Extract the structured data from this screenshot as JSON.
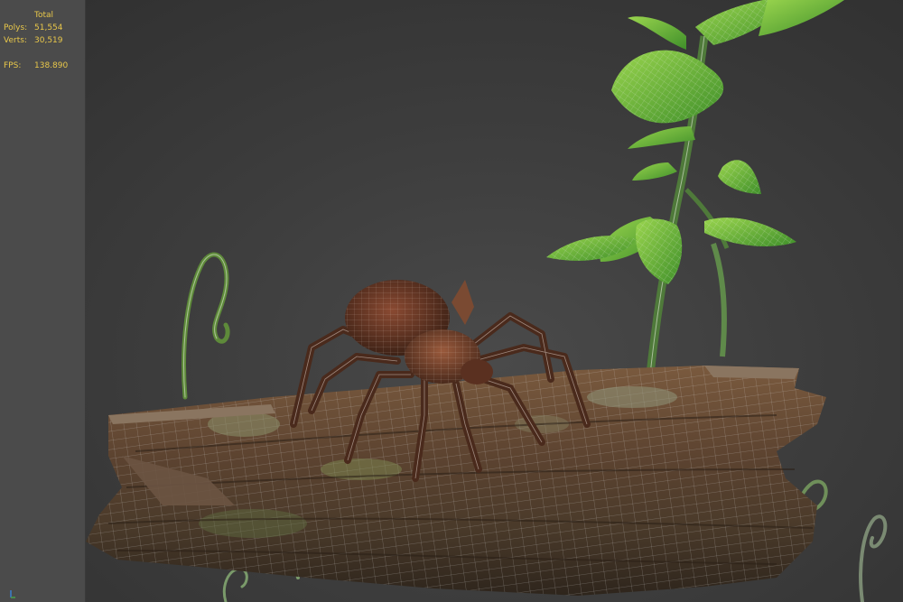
{
  "stats": {
    "header": "Total",
    "polys_label": "Polys:",
    "polys_value": "51,554",
    "verts_label": "Verts:",
    "verts_value": "30,519",
    "fps_label": "FPS:",
    "fps_value": "138.890"
  },
  "colors": {
    "stats_text": "#e8c74a",
    "background": "#3d3d3d",
    "wireframe": "#d8d8d8",
    "leaf": "#5fb23a",
    "log_bark": "#6a4a32",
    "spider": "#6b3b27"
  },
  "scene": {
    "objects": [
      "spider-model",
      "log-model",
      "vine-plant-model",
      "fern-curl-model"
    ]
  }
}
